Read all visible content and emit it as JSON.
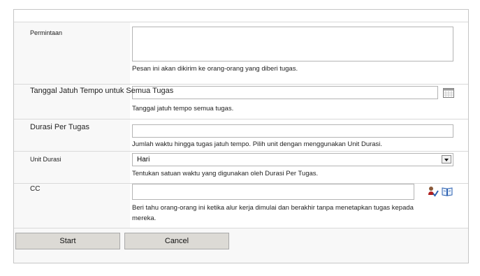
{
  "form": {
    "permintaan": {
      "label": "Permintaan",
      "value": "",
      "help": "Pesan ini akan dikirim ke orang-orang yang diberi tugas."
    },
    "due_date": {
      "label": "Tanggal Jatuh Tempo untuk Semua Tugas",
      "value": "",
      "help": "Tanggal jatuh tempo semua tugas.",
      "icon": "calendar-icon"
    },
    "duration": {
      "label": "Durasi Per Tugas",
      "value": "",
      "help": "Jumlah waktu hingga tugas jatuh tempo. Pilih unit dengan menggunakan Unit Durasi."
    },
    "unit": {
      "label": "Unit Durasi",
      "selected": "Hari",
      "help": "Tentukan satuan waktu yang digunakan oleh Durasi Per Tugas."
    },
    "cc": {
      "label": "CC",
      "value": "",
      "help_line1": "Beri tahu orang-orang ini ketika alur kerja dimulai dan berakhir tanpa menetapkan tugas kepada",
      "help_line2": "mereka.",
      "icons": [
        "check-names-icon",
        "browse-address-book-icon"
      ]
    }
  },
  "buttons": {
    "start": "Start",
    "cancel": "Cancel"
  }
}
